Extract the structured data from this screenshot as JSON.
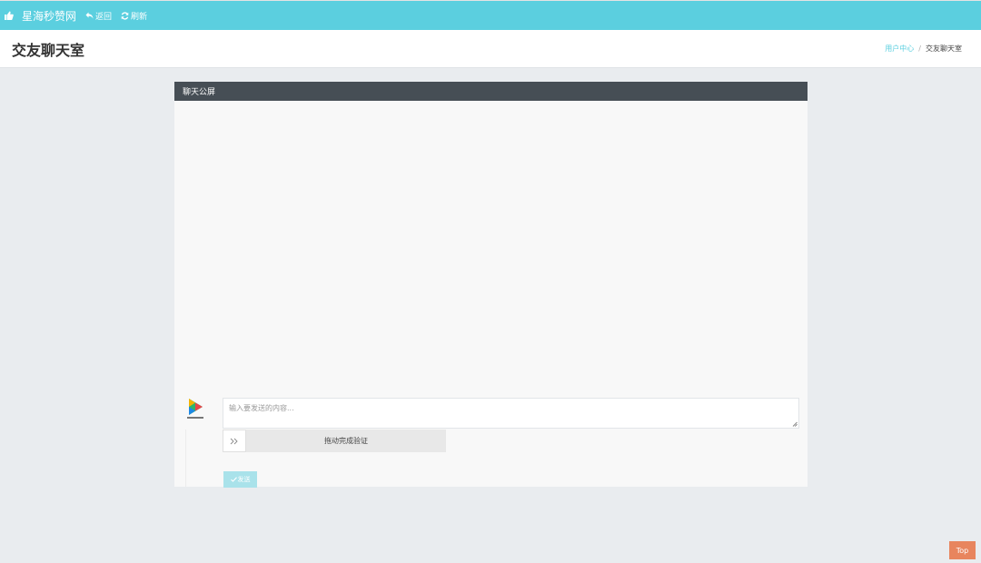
{
  "topbar": {
    "brand": "星海秒赞网",
    "back_label": "返回",
    "refresh_label": "刷新"
  },
  "header": {
    "title": "交友聊天室",
    "breadcrumb": {
      "home": "用户中心",
      "separator": "/",
      "current": "交友聊天室"
    }
  },
  "panel": {
    "title": "聊天公屏",
    "input_placeholder": "输入要发送的内容...",
    "input_value": "",
    "slider_text": "拖动完成验证",
    "send_label": "发送"
  },
  "top_button": {
    "label": "Top"
  },
  "colors": {
    "navbar": "#5bcfdf",
    "panel_header": "#464e55",
    "send_button": "#a9e2ea",
    "top_button": "#e8855e"
  },
  "icons": {
    "brand": "thumbs-up-icon",
    "back": "reply-icon",
    "refresh": "refresh-icon",
    "slider": "double-chevron-right-icon",
    "send": "check-icon",
    "avatar": "play-logo-icon"
  }
}
